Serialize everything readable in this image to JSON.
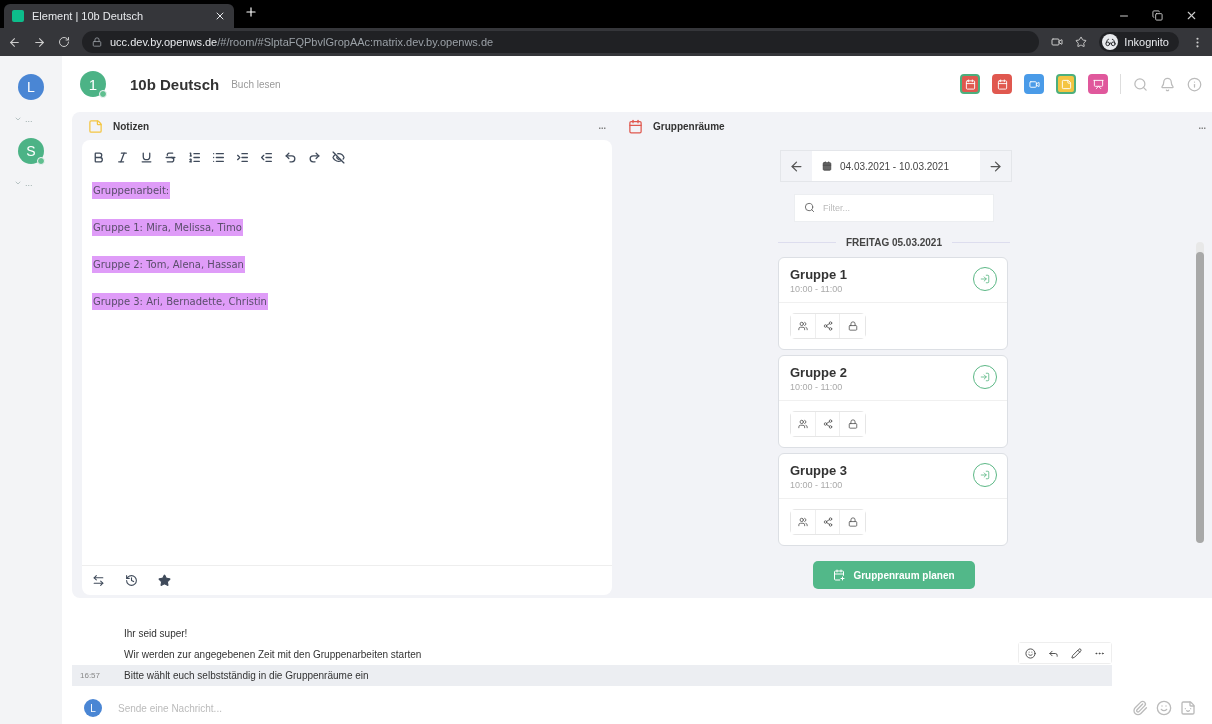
{
  "browser": {
    "tab_title": "Element | 10b Deutsch",
    "url_host": "ucc.dev.by.openws.de",
    "url_path": "/#/room/#SlptaFQPbvlGropAAc:matrix.dev.by.openws.de",
    "profile": "Inkognito"
  },
  "sidebar": {
    "user_avatar": "L",
    "items": [
      {
        "kind": "expander",
        "label": "..."
      },
      {
        "kind": "space",
        "letter": "S"
      },
      {
        "kind": "expander",
        "label": "..."
      }
    ]
  },
  "room": {
    "avatar": "1",
    "name": "10b Deutsch",
    "topic": "Buch lesen"
  },
  "header_apps": [
    {
      "kind": "calendar",
      "color": "#e0584f",
      "selected": true
    },
    {
      "kind": "calendar",
      "color": "#e0584f",
      "selected": false
    },
    {
      "kind": "video",
      "color": "#4a9be8",
      "selected": false
    },
    {
      "kind": "notes",
      "color": "#f4c542",
      "selected": true
    },
    {
      "kind": "board",
      "color": "#e0589c",
      "selected": false
    }
  ],
  "notes": {
    "title": "Notizen",
    "menu": "...",
    "lines": [
      {
        "text": "Gruppenarbeit:",
        "highlighted": true
      },
      {
        "text": "Gruppe 1: Mira, Melissa, Timo",
        "highlighted": true
      },
      {
        "text": "Gruppe 2: Tom, Alena, Hassan",
        "highlighted": true
      },
      {
        "text": "Gruppe 3: Ari, Bernadette, Christin",
        "highlighted": true
      }
    ]
  },
  "groups": {
    "title": "Gruppenräume",
    "menu": "...",
    "date_range": "04.03.2021 - 10.03.2021",
    "filter_placeholder": "Filter...",
    "day": "FREITAG 05.03.2021",
    "rooms": [
      {
        "name": "Gruppe 1",
        "time": "10:00  - 11:00"
      },
      {
        "name": "Gruppe 2",
        "time": "10:00  - 11:00"
      },
      {
        "name": "Gruppe 3",
        "time": "10:00  - 11:00"
      }
    ],
    "button": "Gruppenraum planen"
  },
  "timeline": {
    "messages": [
      {
        "text": "Ihr seid super!",
        "hovered": false
      },
      {
        "text": "Wir werden zur angegebenen Zeit mit den Gruppenarbeiten starten",
        "hovered": false
      },
      {
        "text": "Bitte wählt euch selbstständig in die Gruppenräume ein",
        "time": "16:57",
        "hovered": true
      }
    ]
  },
  "composer": {
    "avatar": "L",
    "placeholder": "Sende eine Nachricht..."
  }
}
